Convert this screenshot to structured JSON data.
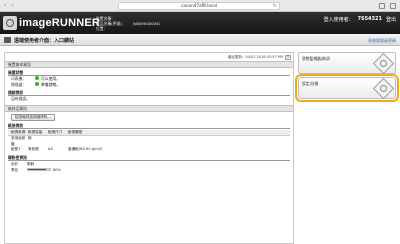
{
  "browser": {
    "url": "canon47af8.local",
    "back": "‹",
    "forward": "›",
    "reload": "↻"
  },
  "header": {
    "logo_text": "imageRUNNER",
    "device_name_label": "裝置名稱：",
    "product_name_label": "產品名稱(序號)：",
    "product_name_value": "(WDHX00004)",
    "location_label": "位置：",
    "login_user_label": "登入使用者：",
    "login_user_value": "7654321",
    "logout": "登出"
  },
  "titlebar": {
    "title": "遠端使用者介面：入口網站",
    "password_link": "系統管理員密碼"
  },
  "main": {
    "last_updated": "最近更新：04/01 2016 03:57 PM",
    "device_basic_info": "裝置基本資訊",
    "device_status": "裝置狀態",
    "printer_label": "印表機：",
    "printer_status": "可以使用。",
    "scanner_label": "掃描器：",
    "scanner_status": "準備就緒。",
    "error_info": "錯誤資訊",
    "error_text": "沒有錯誤。",
    "consumables_info": "耗材品資訊",
    "check_button": "檢查耗材品詳細資料...",
    "paper_info": "紙張資訊",
    "paper_headers": [
      "紙張來源",
      "紙張容量",
      "紙張尺寸",
      "紙張類型"
    ],
    "paper_rows": [
      [
        "多用途紙盤",
        "無",
        "",
        ""
      ],
      [
        "紙匣1",
        "有紙張",
        "A4",
        "普通紙(64-90 g/m2)"
      ]
    ],
    "cartridge_info": "碳粉匣資訊",
    "cartridge_headers": [
      "色彩",
      "剩餘"
    ],
    "cartridge_rows": [
      {
        "color": "黑色",
        "level": "80%",
        "fraction": 0.8
      }
    ]
  },
  "side": {
    "status_monitor": "狀態監視器/取消",
    "settings": "設定/註冊"
  },
  "colors": {
    "header_bg": "#1f1f1f",
    "accent_highlight": "#f0a81f",
    "ok_green": "#3fae29",
    "link_blue": "#3c6eb4"
  }
}
